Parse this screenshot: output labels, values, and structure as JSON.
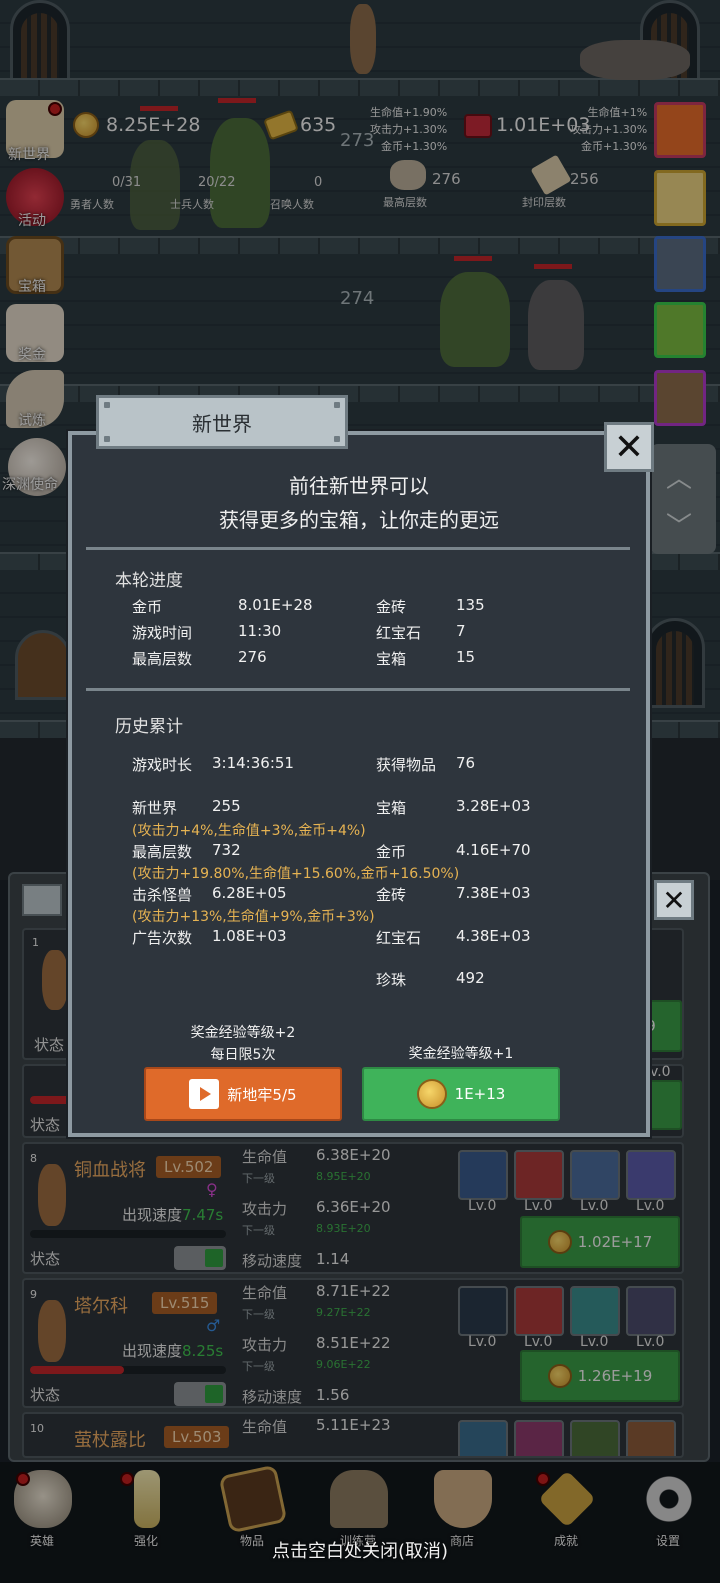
{
  "top": {
    "gold": "8.25E+28",
    "gold_bars": "635",
    "rubies": "1.01E+03",
    "bonus_left": [
      "生命值+1.90%",
      "攻击力+1.30%",
      "金币+1.30%"
    ],
    "bonus_right": [
      "生命值+1%",
      "攻击力+1.30%",
      "金币+1.30%"
    ],
    "floor_top": "273",
    "floor_mid": "274",
    "hero_count": "0/31",
    "hero_label": "勇者人数",
    "soldier_count": "20/22",
    "soldier_label": "士兵人数",
    "summon_count": "0",
    "summon_label": "召唤人数",
    "max_floor": "276",
    "max_floor_label": "最高层数",
    "seal_floor": "256",
    "seal_floor_label": "封印层数"
  },
  "side_menu": [
    "新世界",
    "活动",
    "宝箱",
    "奖金",
    "试炼",
    "深渊使命"
  ],
  "dialog": {
    "title": "新世界",
    "intro_line1": "前往新世界可以",
    "intro_line2": "获得更多的宝箱，让你走的更远",
    "round_header": "本轮进度",
    "round": [
      {
        "label": "金币",
        "value": "8.01E+28",
        "label2": "金砖",
        "value2": "135"
      },
      {
        "label": "游戏时间",
        "value": "11:30",
        "label2": "红宝石",
        "value2": "7"
      },
      {
        "label": "最高层数",
        "value": "276",
        "label2": "宝箱",
        "value2": "15"
      }
    ],
    "history_header": "历史累计",
    "play_time_label": "游戏时长",
    "play_time": "3:14:36:51",
    "items_label": "获得物品",
    "items": "76",
    "new_world_label": "新世界",
    "new_world": "255",
    "new_world_bonus": "(攻击力+4%,生命值+3%,金币+4%)",
    "chest_label": "宝箱",
    "chest": "3.28E+03",
    "max_floor_label": "最高层数",
    "max_floor": "732",
    "max_floor_bonus": "(攻击力+19.80%,生命值+15.60%,金币+16.50%)",
    "gold_label": "金币",
    "gold": "4.16E+70",
    "kills_label": "击杀怪兽",
    "kills": "6.28E+05",
    "kills_bonus": "(攻击力+13%,生命值+9%,金币+3%)",
    "bars_label": "金砖",
    "bars": "7.38E+03",
    "ads_label": "广告次数",
    "ads": "1.08E+03",
    "ruby_label": "红宝石",
    "ruby": "4.38E+03",
    "pearl_label": "珍珠",
    "pearl": "492",
    "left_reward_line1": "奖金经验等级+2",
    "left_reward_line2": "每日限5次",
    "right_reward": "奖金经验等级+1",
    "ad_button": "新地牢5/5",
    "coin_button": "1E+13"
  },
  "heroes": [
    {
      "index": "1",
      "state": "状态"
    },
    {
      "state": "状态"
    },
    {
      "index": "8",
      "name": "铜血战将",
      "level": "Lv.502",
      "speed_label": "出现速度",
      "speed": "7.47s",
      "hp_label": "生命值",
      "hp": "6.38E+20",
      "next_label": "下一级",
      "hp_next": "8.95E+20",
      "atk_label": "攻击力",
      "atk": "6.36E+20",
      "atk_next": "8.93E+20",
      "move_label": "移动速度",
      "move": "1.14",
      "state": "状态",
      "upgrade": "1.02E+17",
      "skills": [
        "Lv.0",
        "Lv.0",
        "Lv.0",
        "Lv.0"
      ]
    },
    {
      "index": "9",
      "name": "塔尔科",
      "level": "Lv.515",
      "speed_label": "出现速度",
      "speed": "8.25s",
      "hp_label": "生命值",
      "hp": "8.71E+22",
      "next_label": "下一级",
      "hp_next": "9.27E+22",
      "atk_label": "攻击力",
      "atk": "8.51E+22",
      "atk_next": "9.06E+22",
      "move_label": "移动速度",
      "move": "1.56",
      "state": "状态",
      "upgrade": "1.26E+19",
      "skills": [
        "Lv.0",
        "Lv.0",
        "Lv.0",
        "Lv.0"
      ]
    },
    {
      "index": "10",
      "name": "萤杖露比",
      "level": "Lv.503",
      "hp_label": "生命值",
      "hp": "5.11E+23"
    }
  ],
  "partial": {
    "btn_tail": "9",
    "lv_tail": "v.0"
  },
  "nav": [
    "英雄",
    "强化",
    "物品",
    "训练营",
    "商店",
    "成就",
    "设置"
  ],
  "footer_hint": "点击空白处关闭(取消)"
}
